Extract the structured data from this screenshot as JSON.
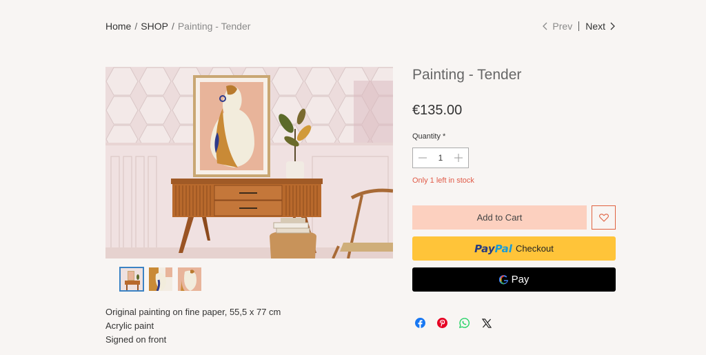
{
  "breadcrumb": {
    "home": "Home",
    "sep1": "/",
    "shop": "SHOP",
    "sep2": "/",
    "current": "Painting - Tender"
  },
  "pager": {
    "prev": "Prev",
    "next": "Next"
  },
  "product": {
    "title": "Painting - Tender",
    "price": "€135.00",
    "quantity_label": "Quantity *",
    "quantity": "1",
    "stock_note": "Only 1 left in stock",
    "description": [
      "Original painting on fine paper,  55,5 x 77 cm",
      "Acrylic paint",
      "Signed on front"
    ]
  },
  "buttons": {
    "add_to_cart": "Add to Cart",
    "paypal_pay": "Pay",
    "paypal_pal": "Pal",
    "paypal_checkout": "Checkout",
    "gpay_label": "Pay"
  },
  "thumbnails": [
    "thumbnail-1",
    "thumbnail-2",
    "thumbnail-3"
  ],
  "share": [
    "facebook-icon",
    "pinterest-icon",
    "whatsapp-icon",
    "x-icon"
  ],
  "colors": {
    "accent": "#e0613f",
    "cart_button": "#fcd0bf",
    "paypal": "#ffc439",
    "stock_warning": "#e05a47"
  }
}
